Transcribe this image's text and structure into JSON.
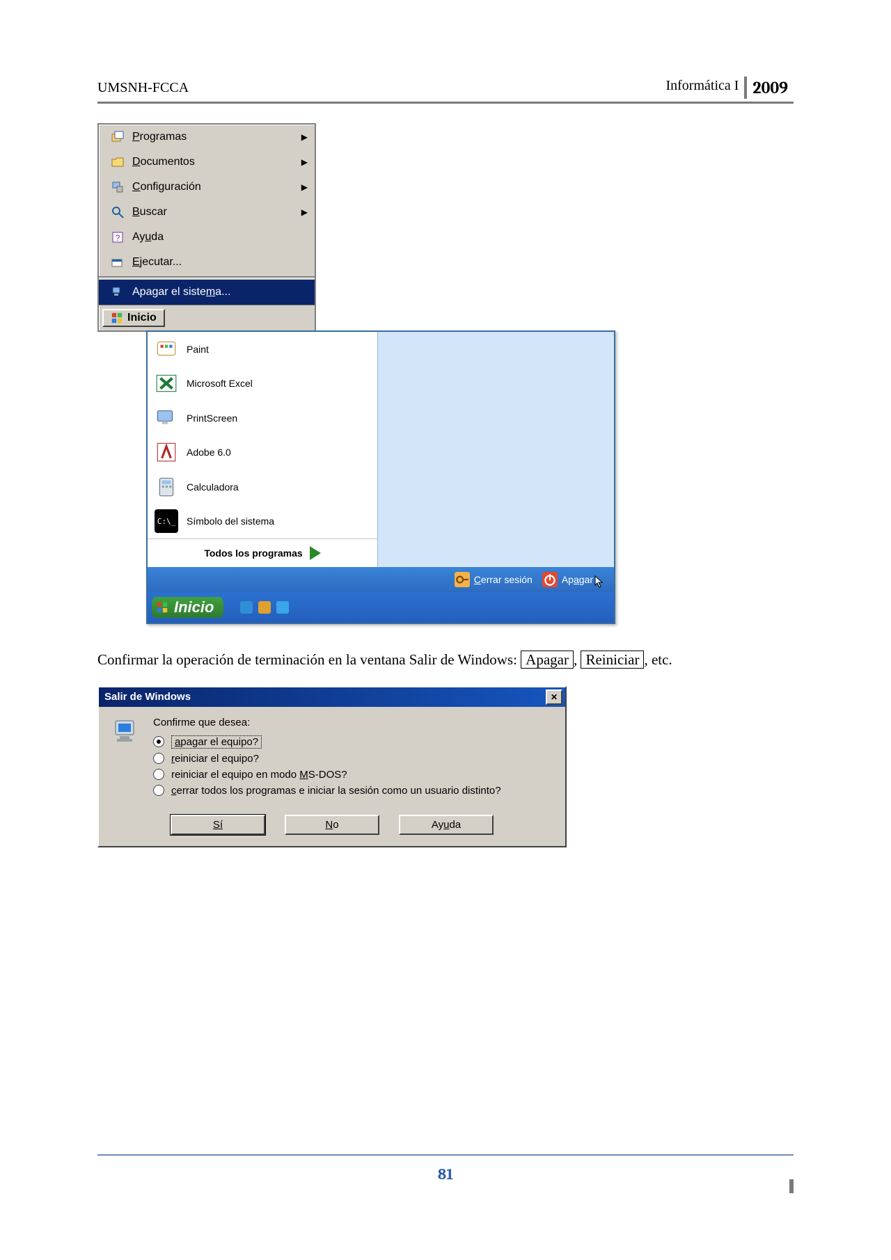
{
  "header": {
    "institution": "UMSNH-FCCA",
    "course": "Informática I",
    "year": "2009"
  },
  "start_menu": {
    "items": [
      {
        "label": "Programas",
        "has_arrow": true,
        "icon": "programs"
      },
      {
        "label": "Documentos",
        "has_arrow": true,
        "icon": "docs"
      },
      {
        "label": "Configuración",
        "has_arrow": true,
        "icon": "settings"
      },
      {
        "label": "Buscar",
        "has_arrow": true,
        "icon": "search"
      },
      {
        "label": "Ayuda",
        "has_arrow": false,
        "icon": "help"
      },
      {
        "label": "Ejecutar...",
        "has_arrow": false,
        "icon": "run"
      }
    ],
    "shutdown_label": "Apagar el sistema...",
    "start_label": "Inicio"
  },
  "xp_menu": {
    "programs": [
      {
        "label": "Paint",
        "icon_name": "paint-icon"
      },
      {
        "label": "Microsoft Excel",
        "icon_name": "excel-icon"
      },
      {
        "label": "PrintScreen",
        "icon_name": "printscreen-icon"
      },
      {
        "label": "Adobe 6.0",
        "icon_name": "adobe-icon"
      },
      {
        "label": "Calculadora",
        "icon_name": "calculator-icon"
      },
      {
        "label": "Símbolo del sistema",
        "icon_name": "cmd-icon"
      }
    ],
    "all_programs": "Todos los programas",
    "logoff": "Cerrar sesión",
    "shutdown": "Apagar",
    "start_label": "Inicio"
  },
  "body_text": {
    "t1": "Confirmar la operación de terminación en la ventana Salir de Windows: ",
    "key1": "Apagar",
    "comma": ", ",
    "key2": "Reiniciar",
    "t2": ", etc."
  },
  "dialog": {
    "title": "Salir de Windows",
    "prompt": "Confirme que desea:",
    "options": [
      {
        "label": "apagar el equipo?",
        "checked": true
      },
      {
        "label": "reiniciar el equipo?",
        "checked": false
      },
      {
        "label": "reiniciar el equipo en modo MS-DOS?",
        "checked": false
      },
      {
        "label": "cerrar todos los programas e iniciar la sesión como un usuario distinto?",
        "checked": false
      }
    ],
    "buttons": {
      "yes": "Sí",
      "no": "No",
      "help": "Ayuda"
    }
  },
  "page_number": "81"
}
